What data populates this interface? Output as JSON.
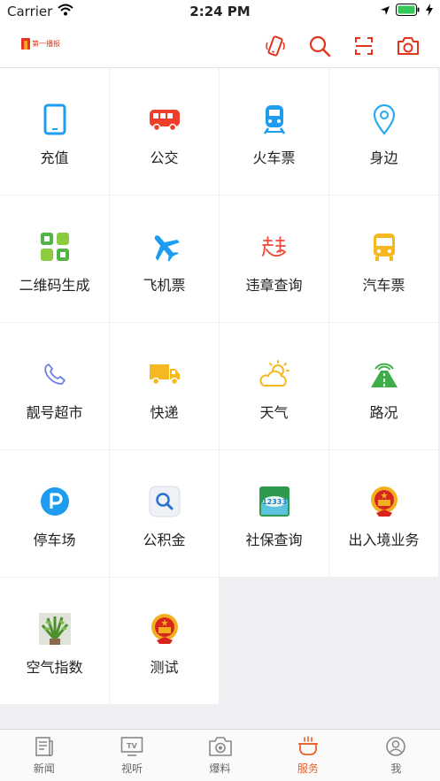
{
  "status_bar": {
    "carrier": "Carrier",
    "time": "2:24 PM"
  },
  "header": {
    "logo_text": "第一播报"
  },
  "services": [
    {
      "label": "充值",
      "icon": "phone-icon"
    },
    {
      "label": "公交",
      "icon": "bus-icon"
    },
    {
      "label": "火车票",
      "icon": "train-icon"
    },
    {
      "label": "身边",
      "icon": "location-pin-icon"
    },
    {
      "label": "二维码生成",
      "icon": "qr-code-icon"
    },
    {
      "label": "飞机票",
      "icon": "airplane-icon"
    },
    {
      "label": "违章查询",
      "icon": "violation-icon"
    },
    {
      "label": "汽车票",
      "icon": "coach-bus-icon"
    },
    {
      "label": "靓号超市",
      "icon": "telephone-handset-icon"
    },
    {
      "label": "快递",
      "icon": "delivery-truck-icon"
    },
    {
      "label": "天气",
      "icon": "weather-icon"
    },
    {
      "label": "路况",
      "icon": "road-icon"
    },
    {
      "label": "停车场",
      "icon": "parking-icon"
    },
    {
      "label": "公积金",
      "icon": "magnifier-app-icon"
    },
    {
      "label": "社保查询",
      "icon": "social-security-icon"
    },
    {
      "label": "出入境业务",
      "icon": "national-emblem-icon"
    },
    {
      "label": "空气指数",
      "icon": "plant-photo-icon"
    },
    {
      "label": "测试",
      "icon": "national-emblem-icon"
    }
  ],
  "tabs": [
    {
      "label": "新闻",
      "icon": "news-icon",
      "active": false
    },
    {
      "label": "视听",
      "icon": "tv-icon",
      "active": false
    },
    {
      "label": "爆料",
      "icon": "camera-icon",
      "active": false
    },
    {
      "label": "服务",
      "icon": "service-cup-icon",
      "active": true
    },
    {
      "label": "我",
      "icon": "profile-icon",
      "active": false
    }
  ],
  "colors": {
    "accent": "#e8632b",
    "header_icon": "#e3341e",
    "grid_bg": "#f0eff4"
  }
}
